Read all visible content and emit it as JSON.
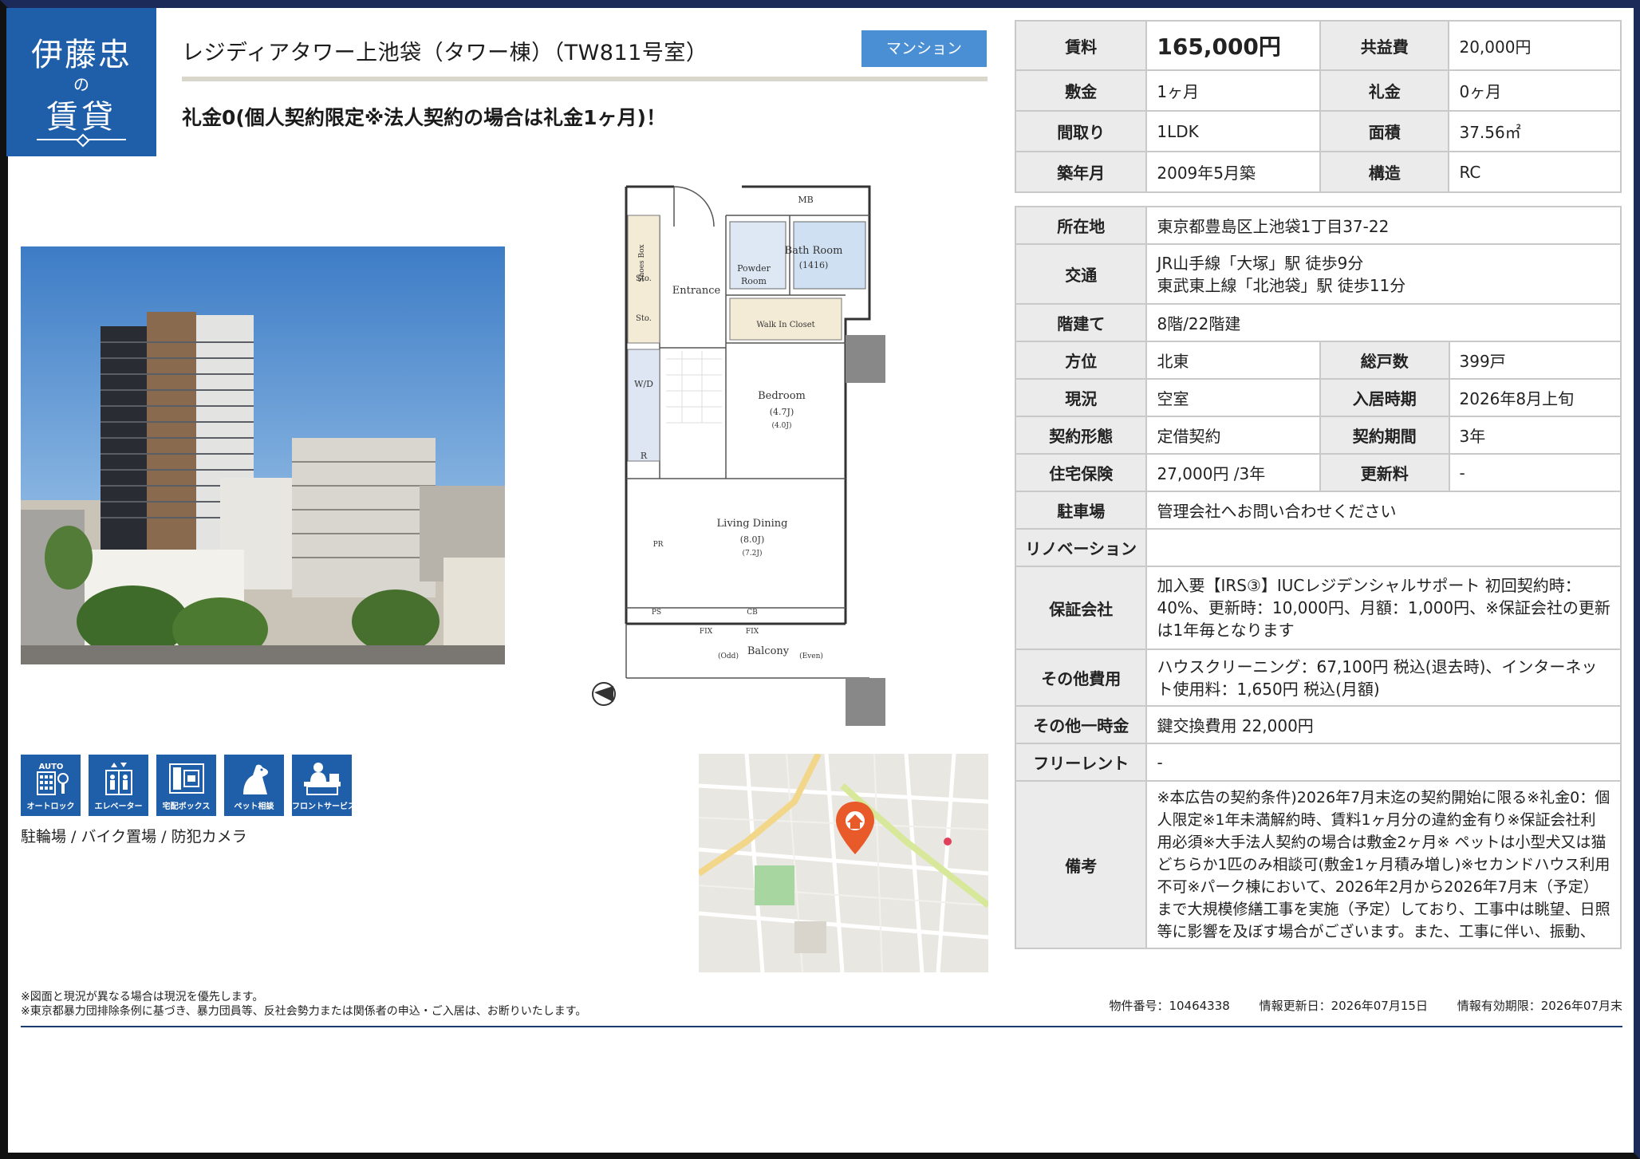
{
  "logo": {
    "line1": "伊藤忠",
    "line2": "の",
    "line3": "賃貸"
  },
  "title": "レジディアタワー上池袋（タワー棟）（TW811号室）",
  "property_type": "マンション",
  "catch_copy": "礼金0(個人契約限定※法人契約の場合は礼金1ヶ月)！",
  "summary": {
    "rent_label": "賃料",
    "rent": "165,000円",
    "common_fee_label": "共益費",
    "common_fee": "20,000円",
    "deposit_label": "敷金",
    "deposit": "1ヶ月",
    "key_money_label": "礼金",
    "key_money": "0ヶ月",
    "layout_label": "間取り",
    "layout": "1LDK",
    "area_label": "面積",
    "area": "37.56㎡",
    "built_label": "築年月",
    "built": "2009年5月築",
    "structure_label": "構造",
    "structure": "RC"
  },
  "details": {
    "address_label": "所在地",
    "address": "東京都豊島区上池袋1丁目37-22",
    "access_label": "交通",
    "access_1": "JR山手線「大塚」駅 徒歩9分",
    "access_2": "東武東上線「北池袋」駅 徒歩11分",
    "floor_label": "階建て",
    "floor": "8階/22階建",
    "direction_label": "方位",
    "direction": "北東",
    "units_label": "総戸数",
    "units": "399戸",
    "status_label": "現況",
    "status": "空室",
    "move_in_label": "入居時期",
    "move_in": "2026年8月上旬",
    "contract_type_label": "契約形態",
    "contract_type": "定借契約",
    "contract_period_label": "契約期間",
    "contract_period": "3年",
    "insurance_label": "住宅保険",
    "insurance": "27,000円 /3年",
    "renewal_fee_label": "更新料",
    "renewal_fee": "-",
    "parking_label": "駐車場",
    "parking": "管理会社へお問い合わせください",
    "renovation_label": "リノベーション",
    "renovation": "",
    "guarantor_label": "保証会社",
    "guarantor": "加入要【IRS③】IUCレジデンシャルサポート 初回契約時：40%、更新時：10,000円、月額：1,000円、※保証会社の更新は1年毎となります",
    "other_fees_label": "その他費用",
    "other_fees": "ハウスクリーニング：67,100円 税込(退去時)、インターネット使用料：1,650円 税込(月額)",
    "other_onetime_label": "その他一時金",
    "other_onetime": "鍵交換費用 22,000円",
    "free_rent_label": "フリーレント",
    "free_rent": "-",
    "remarks_label": "備考",
    "remarks": "※本広告の契約条件)2026年7月末迄の契約開始に限る※礼金0：個人限定※1年未満解約時、賃料1ヶ月分の違約金有り※保証会社利用必須※大手法人契約の場合は敷金2ヶ月※ ペットは小型犬又は猫どちらか1匹のみ相談可(敷金1ヶ月積み増し)※セカンドハウス利用不可※パーク棟において、2026年2月から2026年7月末（予定）まで大規模修繕工事を実施（予定）しており、工事中は眺望、日照等に影響を及ぼす場合がございます。また、工事に伴い、振動、"
  },
  "amenities": [
    {
      "icon": "auto-lock-icon",
      "label": "オートロック",
      "top": "AUTO"
    },
    {
      "icon": "elevator-icon",
      "label": "エレベーター"
    },
    {
      "icon": "delivery-box-icon",
      "label": "宅配ボックス"
    },
    {
      "icon": "pet-icon",
      "label": "ペット相談"
    },
    {
      "icon": "front-service-icon",
      "label": "フロントサービス"
    }
  ],
  "features_text": "駐輪場 / バイク置場 / 防犯カメラ",
  "floorplan": {
    "mb": "MB",
    "shoes_box": "Shoes Box",
    "sto1": "Sto.",
    "sto2": "Sto.",
    "entrance": "Entrance",
    "powder_room_1": "Powder",
    "powder_room_2": "Room",
    "bath_room": "Bath Room",
    "bath_size": "(1416)",
    "walk_in_closet": "Walk In Closet",
    "wd": "W/D",
    "r": "R",
    "bedroom": "Bedroom",
    "bedroom_j1": "(4.7J)",
    "bedroom_j2": "(4.0J)",
    "living": "Living Dining",
    "living_j1": "(8.0J)",
    "living_j2": "(7.2J)",
    "pr": "PR",
    "ps": "PS",
    "cb": "CB",
    "fix1": "FIX",
    "fix2": "FIX",
    "balcony": "Balcony",
    "odd": "(Odd)",
    "even": "(Even)"
  },
  "notes": {
    "line1": "※図面と現況が異なる場合は現況を優先します。",
    "line2": "※東京都暴力団排除条例に基づき、暴力団員等、反社会勢力または関係者の申込・ご入居は、お断りいたします。"
  },
  "meta": {
    "property_no": "物件番号：10464338",
    "updated": "情報更新日：2026年07月15日",
    "valid_until": "情報有効期限：2026年07月末"
  },
  "colors": {
    "brand": "#1f5ea8",
    "badge": "#4a8fd3",
    "header_cell": "#ebebeb"
  }
}
